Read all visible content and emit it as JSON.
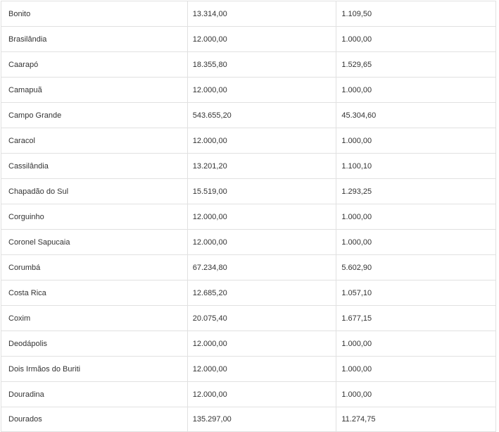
{
  "table": {
    "rows": [
      [
        "Bonito",
        "13.314,00",
        "1.109,50"
      ],
      [
        "Brasilândia",
        "12.000,00",
        "1.000,00"
      ],
      [
        "Caarapó",
        "18.355,80",
        "1.529,65"
      ],
      [
        "Camapuã",
        "12.000,00",
        "1.000,00"
      ],
      [
        "Campo Grande",
        "543.655,20",
        "45.304,60"
      ],
      [
        "Caracol",
        "12.000,00",
        "1.000,00"
      ],
      [
        "Cassilândia",
        "13.201,20",
        "1.100,10"
      ],
      [
        "Chapadão do Sul",
        "15.519,00",
        "1.293,25"
      ],
      [
        "Corguinho",
        "12.000,00",
        "1.000,00"
      ],
      [
        "Coronel Sapucaia",
        "12.000,00",
        "1.000,00"
      ],
      [
        "Corumbá",
        "67.234,80",
        "5.602,90"
      ],
      [
        "Costa Rica",
        "12.685,20",
        "1.057,10"
      ],
      [
        "Coxim",
        "20.075,40",
        "1.677,15"
      ],
      [
        "Deodápolis",
        "12.000,00",
        "1.000,00"
      ],
      [
        "Dois Irmãos do Buriti",
        "12.000,00",
        "1.000,00"
      ],
      [
        "Douradina",
        "12.000,00",
        "1.000,00"
      ],
      [
        "Dourados",
        "135.297,00",
        "11.274,75"
      ]
    ]
  }
}
